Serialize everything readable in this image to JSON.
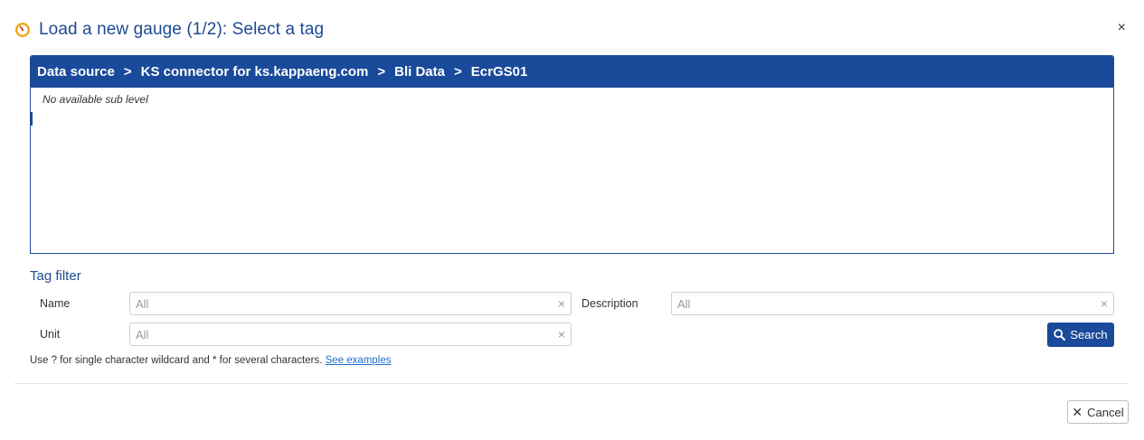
{
  "dialog": {
    "title": "Load a new gauge (1/2): Select a tag",
    "close_symbol": "×"
  },
  "breadcrumb": {
    "separator": ">",
    "items": [
      "Data source",
      "KS connector for ks.kappaeng.com",
      "Bli Data",
      "EcrGS01"
    ]
  },
  "browser": {
    "empty_message": "No available sub level"
  },
  "tag_filter": {
    "title": "Tag filter",
    "name_label": "Name",
    "name_placeholder": "All",
    "description_label": "Description",
    "description_placeholder": "All",
    "unit_label": "Unit",
    "unit_placeholder": "All",
    "clear_symbol": "×",
    "search_label": "Search",
    "hint_text": "Use ? for single character wildcard and * for several characters. ",
    "hint_link": "See examples"
  },
  "footer": {
    "cancel_label": "Cancel",
    "cancel_symbol": "✕"
  },
  "colors": {
    "accent": "#1a4a9a",
    "title": "#1e4a93",
    "link": "#1c6fc9",
    "gauge_outer": "#f0a81c",
    "gauge_needle": "#d9412b"
  }
}
